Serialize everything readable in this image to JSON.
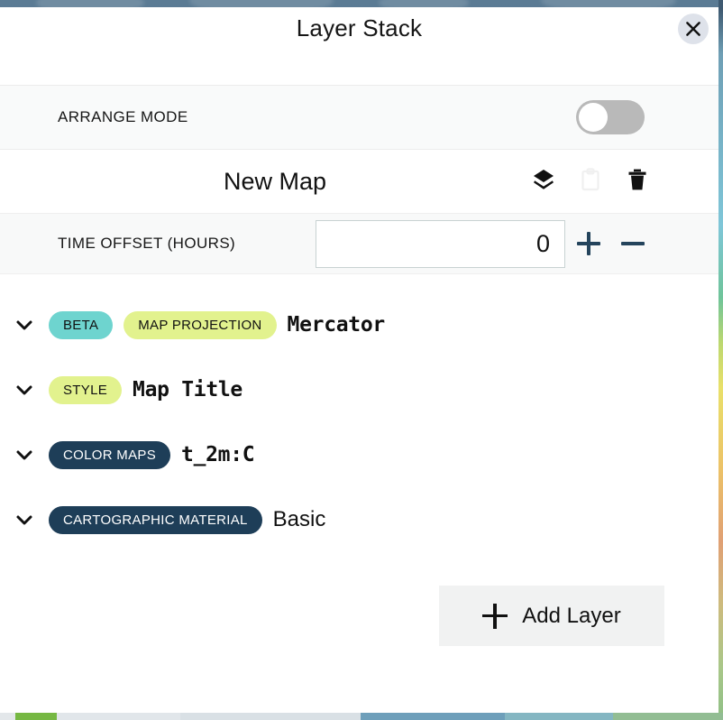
{
  "window": {
    "title": "Layer Stack",
    "close_icon": "close-icon"
  },
  "arrange": {
    "label": "ARRANGE MODE",
    "toggle_state": "off"
  },
  "map": {
    "name": "New Map",
    "actions": [
      {
        "icon": "layers-icon",
        "enabled": true
      },
      {
        "icon": "clipboard-paste-icon",
        "enabled": false
      },
      {
        "icon": "trash-delete-icon",
        "enabled": true
      }
    ]
  },
  "time_offset": {
    "label": "TIME OFFSET (HOURS)",
    "value": "0",
    "placeholder": "0",
    "increment_label": "+",
    "decrement_label": "−"
  },
  "layers": [
    {
      "chevron": "chevron-down-icon",
      "tags": [
        {
          "text": "BETA",
          "style": "teal"
        },
        {
          "text": "MAP PROJECTION",
          "style": "lime"
        }
      ],
      "value": "Mercator",
      "value_font": "mono"
    },
    {
      "chevron": "chevron-down-icon",
      "tags": [
        {
          "text": "STYLE",
          "style": "lime"
        }
      ],
      "value": "Map Title",
      "value_font": "mono"
    },
    {
      "chevron": "chevron-down-icon",
      "tags": [
        {
          "text": "COLOR MAPS",
          "style": "navy"
        }
      ],
      "value": "t_2m:C",
      "value_font": "mono"
    },
    {
      "chevron": "chevron-down-icon",
      "tags": [
        {
          "text": "CARTOGRAPHIC MATERIAL",
          "style": "navy"
        }
      ],
      "value": "Basic",
      "value_font": "sans"
    }
  ],
  "add_layer": {
    "label": "Add Layer",
    "icon": "plus-icon"
  },
  "colors": {
    "badge_teal": "#6ed4cf",
    "badge_lime": "#e2f28e",
    "badge_navy": "#1e3e58",
    "stepper_navy": "#24445c",
    "toggle_track": "#b9b9b9",
    "close_button_bg": "#dee2ea",
    "add_layer_bg": "#f1f2f2",
    "row_alt_bg": "#f8f9f9"
  }
}
